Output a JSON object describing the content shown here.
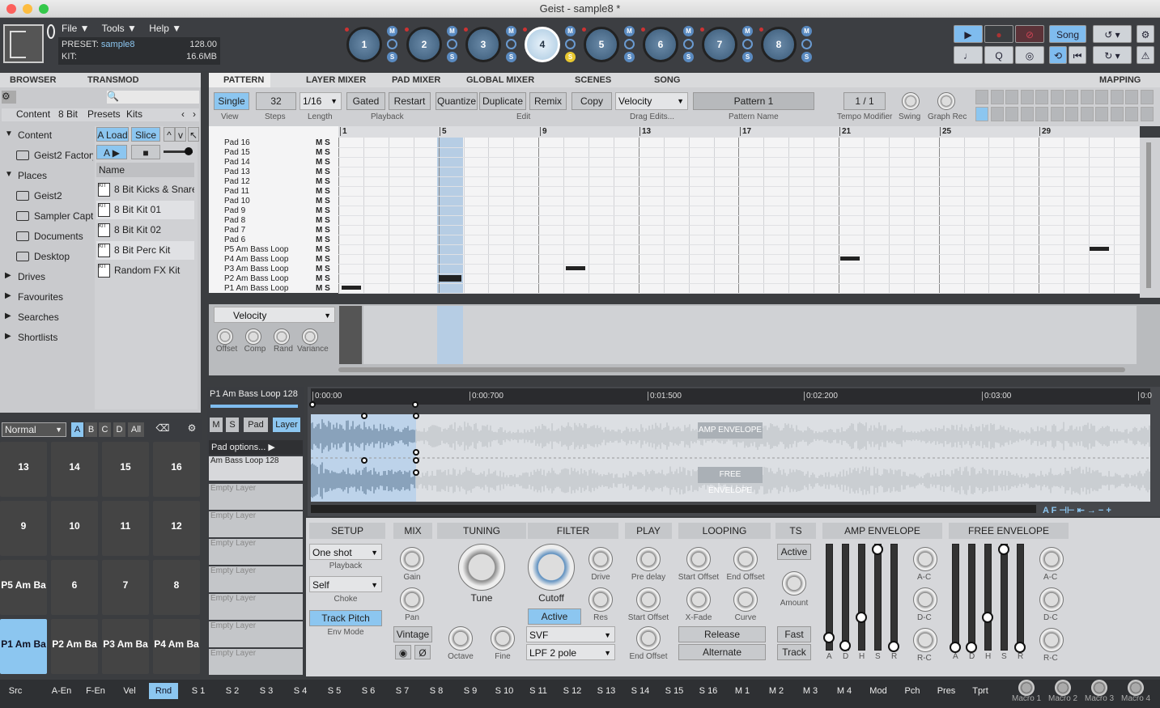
{
  "window": {
    "title": "Geist - sample8 *"
  },
  "menu": [
    "File ▼",
    "Tools ▼",
    "Help ▼"
  ],
  "info": {
    "preset_label": "PRESET:",
    "preset": "sample8",
    "kit_label": "KIT:",
    "tempo": "128.00",
    "memory": "16.6MB"
  },
  "pads_top": [
    "1",
    "2",
    "3",
    "4",
    "5",
    "6",
    "7",
    "8"
  ],
  "transport": {
    "song": "Song",
    "q": "Q"
  },
  "left_tabs": [
    "BROWSER",
    "TRANSMOD"
  ],
  "main_tabs": [
    "PATTERN",
    "LAYER MIXER",
    "PAD MIXER",
    "GLOBAL MIXER",
    "SCENES",
    "SONG",
    "MAPPING"
  ],
  "breadcrumb": [
    "Content",
    "8 Bit",
    "Presets",
    "Kits"
  ],
  "browser": {
    "tree": [
      "Content",
      "Geist2 Factory",
      "Places",
      "Geist2",
      "Sampler Capt",
      "Documents",
      "Desktop",
      "Drives",
      "Favourites",
      "Searches",
      "Shortlists"
    ],
    "load": "A Load",
    "slice": "Slice",
    "a": "A",
    "name_header": "Name",
    "files": [
      "8 Bit Kicks & Snare",
      "8 Bit Kit 01",
      "8 Bit Kit 02",
      "8 Bit Perc Kit",
      "Random FX Kit"
    ]
  },
  "pattern_toolbar": {
    "single": "Single",
    "steps": "32",
    "length": "1/16",
    "gated": "Gated",
    "restart": "Restart",
    "quantize": "Quantize",
    "duplicate": "Duplicate",
    "remix": "Remix",
    "copy": "Copy",
    "velocity": "Velocity",
    "pattern_name": "Pattern 1",
    "tempo_mod": "1 / 1",
    "labels": {
      "view": "View",
      "steps": "Steps",
      "length": "Length",
      "playback": "Playback",
      "edit": "Edit",
      "drag": "Drag Edits...",
      "pname": "Pattern Name",
      "tempo": "Tempo Modifier",
      "swing": "Swing",
      "graph": "Graph Rec"
    }
  },
  "bar_numbers": [
    "1",
    "5",
    "9",
    "13",
    "17",
    "21",
    "25",
    "29"
  ],
  "rows": [
    "Pad 16",
    "Pad 15",
    "Pad 14",
    "Pad 13",
    "Pad 12",
    "Pad 11",
    "Pad 10",
    "Pad 9",
    "Pad 8",
    "Pad 7",
    "Pad 6",
    "P5 Am Bass Loop",
    "P4 Am Bass Loop",
    "P3 Am Bass Loop",
    "P2 Am Bass Loop",
    "P1 Am Bass Loop"
  ],
  "ms": "M S",
  "velocity_panel": {
    "title": "Velocity",
    "knobs": [
      "Offset",
      "Comp",
      "Rand",
      "Variance"
    ]
  },
  "pad_mode": {
    "mode": "Normal",
    "banks": [
      "A",
      "B",
      "C",
      "D",
      "All"
    ]
  },
  "pads": [
    [
      "13",
      "14",
      "15",
      "16"
    ],
    [
      "9",
      "10",
      "11",
      "12"
    ],
    [
      "P5 Am Ba",
      "6",
      "7",
      "8"
    ],
    [
      "P1 Am Ba",
      "P2 Am Ba",
      "P3 Am Ba",
      "P4 Am Ba"
    ]
  ],
  "layer": {
    "name": "P1 Am Bass Loop 128",
    "buttons": [
      "M",
      "S",
      "Pad",
      "Layer"
    ],
    "pad_options": "Pad options...",
    "layer1": "Am Bass Loop 128",
    "empty": "Empty Layer"
  },
  "timeline": [
    "0:00:00",
    "0:00:700",
    "0:01:500",
    "0:02:200",
    "0:03:00",
    "0:0"
  ],
  "envelopes": {
    "amp": "AMP ENVELOPE",
    "free": "FREE ENVELOPE"
  },
  "sections": [
    "SETUP",
    "MIX",
    "TUNING",
    "FILTER",
    "PLAY",
    "LOOPING",
    "TS",
    "AMP ENVELOPE",
    "FREE ENVELOPE"
  ],
  "setup": {
    "oneshot": "One shot",
    "playback": "Playback",
    "self": "Self",
    "choke": "Choke",
    "track_pitch": "Track Pitch",
    "env_mode": "Env Mode"
  },
  "mix": {
    "gain": "Gain",
    "pan": "Pan",
    "vintage": "Vintage"
  },
  "tuning": {
    "tune": "Tune",
    "octave": "Octave",
    "fine": "Fine"
  },
  "filter": {
    "cutoff": "Cutoff",
    "drive": "Drive",
    "res": "Res",
    "active": "Active",
    "svf": "SVF",
    "lpf": "LPF 2 pole"
  },
  "play": {
    "pre": "Pre delay",
    "start": "Start Offset",
    "end": "End Offset"
  },
  "looping": {
    "start": "Start Offset",
    "end": "End Offset",
    "xfade": "X-Fade",
    "curve": "Curve",
    "release": "Release",
    "alternate": "Alternate"
  },
  "ts": {
    "active": "Active",
    "amount": "Amount",
    "fast": "Fast",
    "track": "Track"
  },
  "env_labels": [
    "A",
    "D",
    "H",
    "S",
    "R"
  ],
  "env_knobs": [
    "A-C",
    "D-C",
    "R-C"
  ],
  "bottom": [
    "Src",
    "A-En",
    "F-En",
    "Vel",
    "Rnd",
    "S 1",
    "S 2",
    "S 3",
    "S 4",
    "S 5",
    "S 6",
    "S 7",
    "S 8",
    "S 9",
    "S 10",
    "S 11",
    "S 12",
    "S 13",
    "S 14",
    "S 15",
    "S 16",
    "M 1",
    "M 2",
    "M 3",
    "M 4",
    "Mod",
    "Pch",
    "Pres",
    "Tprt"
  ],
  "macros": [
    "Macro 1",
    "Macro 2",
    "Macro 3",
    "Macro 4"
  ]
}
